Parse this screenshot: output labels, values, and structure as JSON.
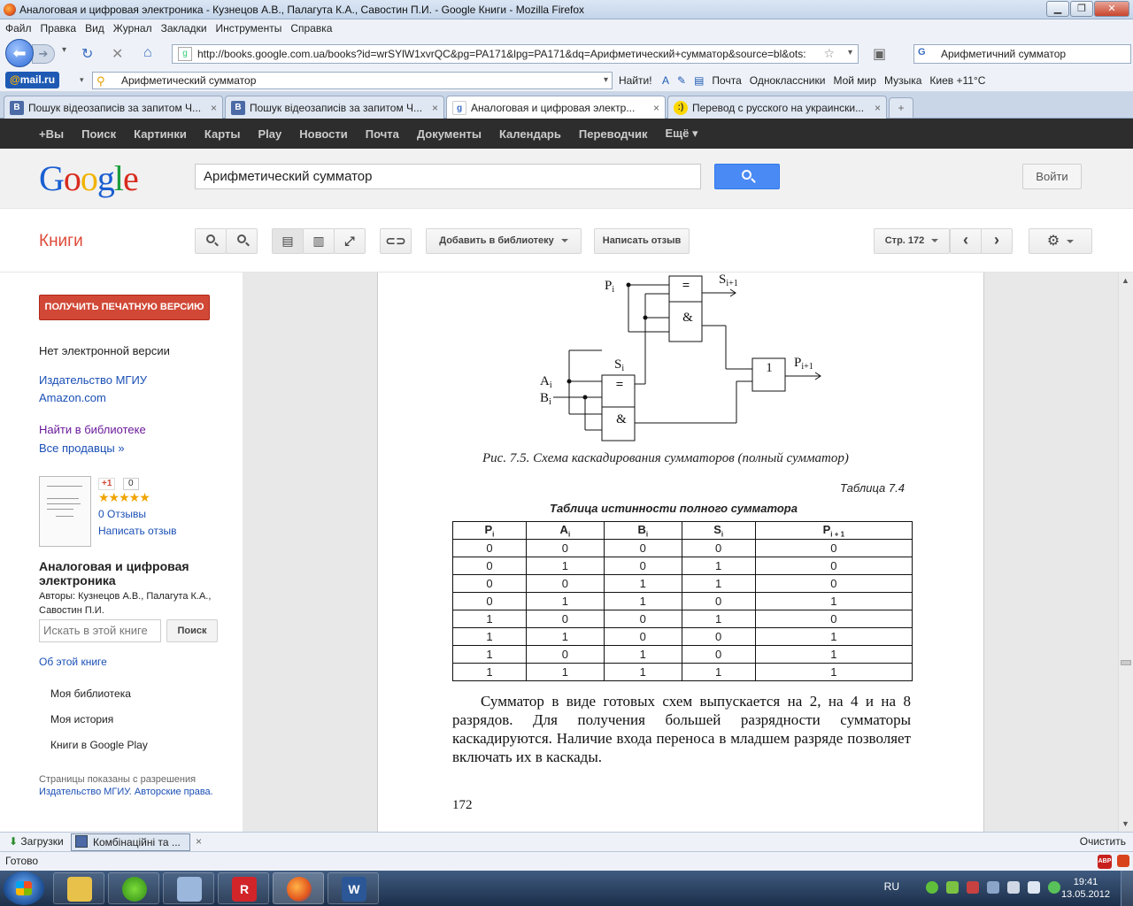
{
  "window": {
    "title": "Аналоговая и цифровая электроника - Кузнецов А.В., Палагута К.А., Савостин П.И. - Google Книги - Mozilla Firefox",
    "minimize": "▁",
    "maximize": "❐",
    "close": "✕"
  },
  "menu": [
    "Файл",
    "Правка",
    "Вид",
    "Журнал",
    "Закладки",
    "Инструменты",
    "Справка"
  ],
  "nav": {
    "url": "http://books.google.com.ua/books?id=wrSYlW1xvrQC&pg=PA171&lpg=PA171&dq=Арифметический+сумматор&source=bl&ots:",
    "search_engine_glyph": "G",
    "search_value": "Арифметичний сумматор"
  },
  "mailru": {
    "logo_prefix": "@",
    "logo_text": "mail.ru",
    "search_value": "Арифметический сумматор",
    "find_label": "Найти!",
    "items": [
      "Почта",
      "Одноклассники",
      "Мой мир",
      "Музыка",
      "Киев +11°C"
    ]
  },
  "tabs": [
    {
      "label": "Пошук відеозаписів за запитом Ч...",
      "icon": "В",
      "active": false
    },
    {
      "label": "Пошук відеозаписів за запитом Ч...",
      "icon": "В",
      "active": false
    },
    {
      "label": "Аналоговая и цифровая электр...",
      "icon": "g",
      "active": true
    },
    {
      "label": "Перевод с русского на украински...",
      "icon": ":)",
      "active": false
    }
  ],
  "tab_close": "×",
  "newtab": "+",
  "gbar": [
    "+Вы",
    "Поиск",
    "Картинки",
    "Карты",
    "Play",
    "Новости",
    "Почта",
    "Документы",
    "Календарь",
    "Переводчик",
    "Ещё ▾"
  ],
  "google": {
    "search_value": "Арифметический сумматор",
    "signin_label": "Войти"
  },
  "books_toolbar": {
    "section_title": "Книги",
    "add_to_library": "Добавить в библиотеку",
    "write_review": "Написать отзыв",
    "page_label": "Стр. 172",
    "prev": "‹",
    "next": "›",
    "settings": "⚙"
  },
  "sidebar": {
    "print_button": "ПОЛУЧИТЬ ПЕЧАТНУЮ ВЕРСИЮ",
    "no_ebook": "Нет электронной версии",
    "publisher_link": "Издательство МГИУ",
    "amazon_link": "Amazon.com",
    "find_library": "Найти в библиотеке",
    "all_sellers": "Все продавцы »",
    "gplus_label": "+1",
    "gplus_count": "0",
    "stars": "★★★★★",
    "reviews_count": "0 Отзывы",
    "write_review": "Написать отзыв",
    "book_title": "Аналоговая и цифровая электроника",
    "authors": "Авторы: Кузнецов А.В., Палагута К.А., Савостин П.И.",
    "search_placeholder": "Искать в этой книге",
    "search_button": "Поиск",
    "about_book": "Об этой книге",
    "my_library": "Моя библиотека",
    "my_history": "Моя история",
    "play_books": "Книги в Google Play",
    "permission_note": "Страницы показаны с разрешения",
    "permission_link": "Издательство МГИУ. Авторские права."
  },
  "page": {
    "diagram": {
      "p_in": "P",
      "s_out": "S",
      "s_mid": "S",
      "a_in": "A",
      "b_in": "B",
      "p_out": "P",
      "sub_i": "i",
      "sub_i1": "i+1",
      "eq_gate": "=",
      "and_gate": "&",
      "or_gate": "1"
    },
    "figure_caption": "Рис. 7.5. Схема каскадирования сумматоров (полный сумматор)",
    "table_number": "Таблица 7.4",
    "table_title": "Таблица истинности полного сумматора",
    "table_headers": [
      "P",
      "A",
      "B",
      "S",
      "P"
    ],
    "table_header_subs": [
      "i",
      "i",
      "i",
      "i",
      "i + 1"
    ],
    "table_rows": [
      [
        "0",
        "0",
        "0",
        "0",
        "0"
      ],
      [
        "0",
        "1",
        "0",
        "1",
        "0"
      ],
      [
        "0",
        "0",
        "1",
        "1",
        "0"
      ],
      [
        "0",
        "1",
        "1",
        "0",
        "1"
      ],
      [
        "1",
        "0",
        "0",
        "1",
        "0"
      ],
      [
        "1",
        "1",
        "0",
        "0",
        "1"
      ],
      [
        "1",
        "0",
        "1",
        "0",
        "1"
      ],
      [
        "1",
        "1",
        "1",
        "1",
        "1"
      ]
    ],
    "body_text": "Сумматор в виде готовых схем выпускается на 2, на 4 и на 8 разрядов. Для получения большей разрядности сумматоры каскадируются. Наличие входа переноса в младшем разряде позволяет включать их в каскады.",
    "page_number": "172"
  },
  "downloads": {
    "downloads_label": "Загрузки",
    "item_label": "Комбінаційні та ...",
    "close_glyph": "×",
    "clear_label": "Очистить"
  },
  "status": {
    "text": "Готово",
    "abp": "ABP"
  },
  "taskbar": {
    "lang": "RU",
    "time": "19:41",
    "date": "13.05.2012"
  },
  "colors": {
    "accent_red": "#dd4b39",
    "print_btn": "#d14836",
    "link_blue": "#1a4fb5",
    "visited_purple": "#6a1b9a",
    "search_blue": "#4a8af4",
    "gbar_bg": "#2d2d2d"
  }
}
